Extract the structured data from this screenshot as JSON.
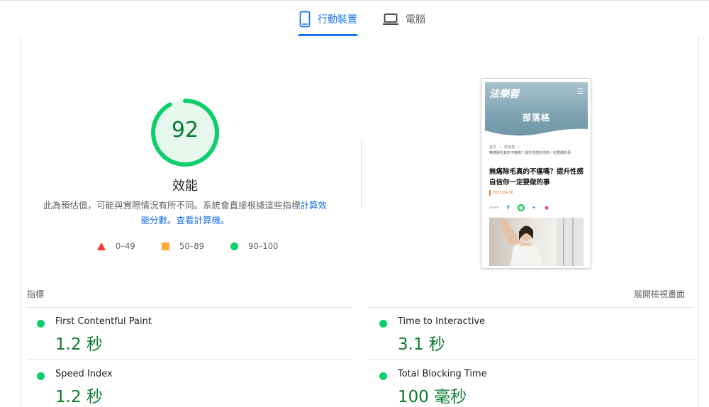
{
  "tabs": {
    "mobile_label": "行動裝置",
    "desktop_label": "電腦",
    "active": "mobile"
  },
  "performance": {
    "score": "92",
    "score_fraction": 0.92,
    "title": "效能",
    "description_text": "此為預估值，可能與實際情況有所不同。系統會直接根據這些指標",
    "description_link1": "計算效能分數",
    "description_sep": "。",
    "description_link2": "查看計算機。"
  },
  "legend": [
    {
      "range": "0–49",
      "shape": "triangle",
      "color": "#ff3333"
    },
    {
      "range": "50–89",
      "shape": "square",
      "color": "#ffaa33"
    },
    {
      "range": "90–100",
      "shape": "circle",
      "color": "#0cce6b"
    }
  ],
  "screenshot": {
    "logo": "法樂蓉",
    "banner_title": "部落格",
    "crumb_home": "首頁",
    "crumb_sep": "»",
    "crumb_blog": "部落格",
    "crumb_path": "無痛除毛真的不痛嗎？提升性感自信你一定要做的事",
    "heading": "無痛除毛真的不痛嗎？提升性感自信你一定要做的事",
    "date": "2022/04/26",
    "share_label": "share"
  },
  "metrics": {
    "header": "指標",
    "expand_label": "展開檢視畫面",
    "items": [
      {
        "name": "First Contentful Paint",
        "value": "1.2 秒"
      },
      {
        "name": "Time to Interactive",
        "value": "3.1 秒"
      },
      {
        "name": "Speed Index",
        "value": "1.2 秒"
      },
      {
        "name": "Total Blocking Time",
        "value": "100 毫秒"
      }
    ]
  },
  "colors": {
    "accent": "#1a73e8",
    "pass": "#0cce6b",
    "pass_text": "#0a7a2f",
    "average": "#ffaa33",
    "fail": "#ff3333"
  }
}
